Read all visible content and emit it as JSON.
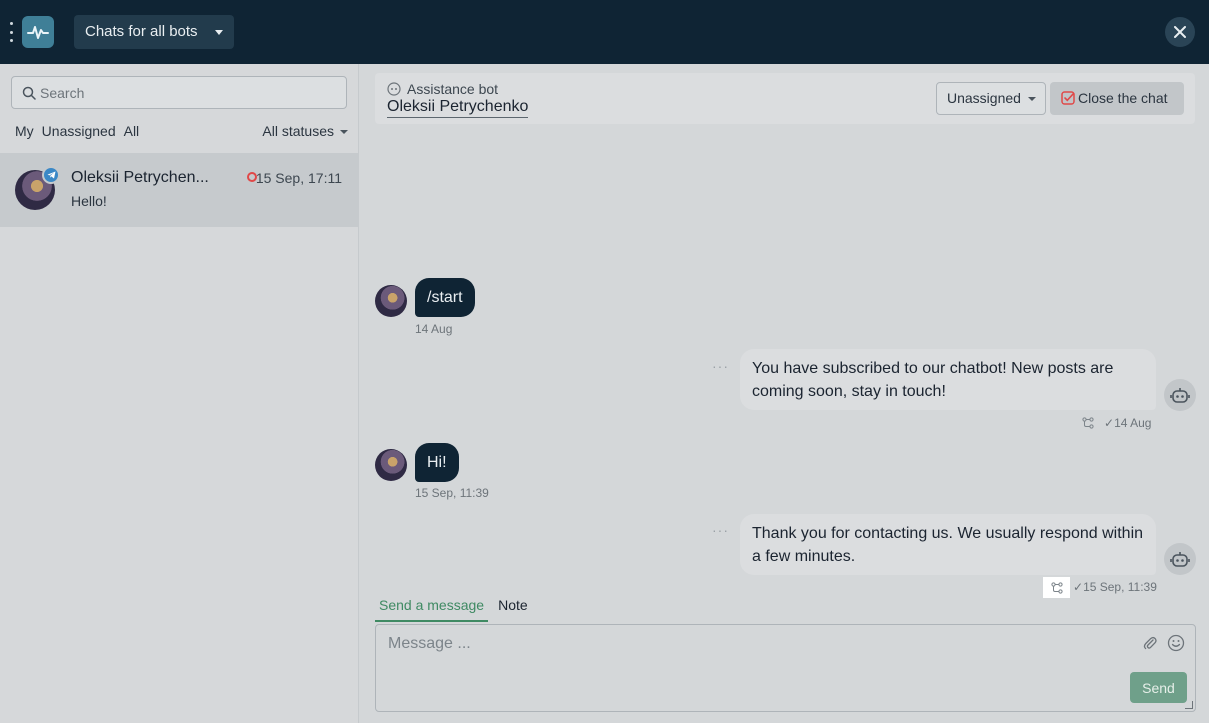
{
  "topbar": {
    "bot_selector_label": "Chats for all bots",
    "menu_icon": "kebab-menu-icon",
    "logo_icon": "pulse-logo-icon",
    "close_icon": "close-icon"
  },
  "sidebar": {
    "search": {
      "placeholder": "Search",
      "value": ""
    },
    "filters": [
      "My",
      "Unassigned",
      "All"
    ],
    "status_filter": "All statuses",
    "chats": [
      {
        "name": "Oleksii Petrychen...",
        "time": "15 Sep, 17:11",
        "preview": "Hello!",
        "channel_icon": "telegram-icon",
        "status_color": "#e04848"
      }
    ]
  },
  "conversation": {
    "bot_name": "Assistance bot",
    "contact_name": "Oleksii Petrychenko",
    "assignee": "Unassigned",
    "close_chat_label": "Close the chat",
    "messages": [
      {
        "direction": "in",
        "text": "/start",
        "time": "14 Aug"
      },
      {
        "direction": "out",
        "text": "You have subscribed to our chatbot! New posts are coming soon, stay in touch!",
        "time": "14 Aug"
      },
      {
        "direction": "in",
        "text": "Hi!",
        "time": "15 Sep, 11:39"
      },
      {
        "direction": "out",
        "text": "Thank you for contacting us. We usually respond within a few minutes.",
        "time": "15 Sep, 11:39"
      }
    ],
    "more_glyph": "···",
    "check_glyph": "✓"
  },
  "composer": {
    "tabs": [
      "Send a message",
      "Note"
    ],
    "placeholder": "Message ...",
    "value": "",
    "send_label": "Send"
  },
  "colors": {
    "topbar_bg": "#0f2434",
    "accent_green": "#3f8a63",
    "send_button": "#6fa08a",
    "incoming_bubble": "#0f2434",
    "close_chat_icon": "#e04848"
  }
}
